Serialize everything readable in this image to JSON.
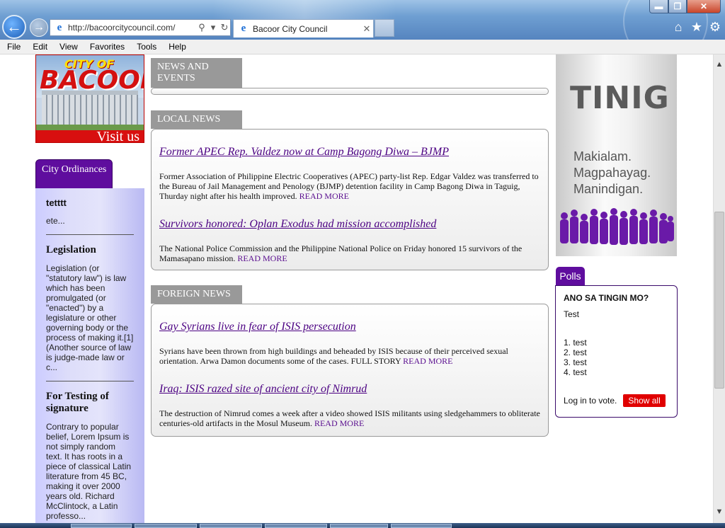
{
  "browser": {
    "url": "http://bacoorcitycouncil.com/",
    "tab_title": "Bacoor City Council",
    "menu": [
      "File",
      "Edit",
      "View",
      "Favorites",
      "Tools",
      "Help"
    ]
  },
  "logo": {
    "line1": "CITY OF",
    "line2": "BACOOR",
    "visit": "Visit us"
  },
  "ordinances": {
    "tab_label": "City Ordinances",
    "items": [
      {
        "title": "tetttt",
        "body": "ete..."
      },
      {
        "title": "Legislation",
        "body": "Legislation (or \"statutory law\") is law which has been promulgated (or \"enacted\") by a legislature or other governing body or the process of making it.[1] (Another source of law is judge-made law or c..."
      },
      {
        "title": "For Testing of signature",
        "body": "Contrary to popular belief, Lorem Ipsum is not simply random text. It has roots in a piece of classical Latin literature from 45 BC, making it over 2000 years old. Richard McClintock, a Latin professo..."
      }
    ]
  },
  "news_events": {
    "tab_label": "NEWS AND EVENTS"
  },
  "local_news": {
    "tab_label": "LOCAL NEWS",
    "articles": [
      {
        "title": "Former APEC Rep. Valdez now at Camp Bagong Diwa – BJMP",
        "body": "Former Association of Philippine Electric Cooperatives (APEC) party-list Rep. Edgar Valdez was transferred to the Bureau of Jail Management and Penology (BJMP) detention facility in Camp Bagong Diwa in Taguig, Thurday night after his health improved.",
        "read_more": "READ MORE"
      },
      {
        "title": "Survivors honored: Oplan Exodus had mission accomplished",
        "body": "The National Police Commission and the Philippine National Police on Friday honored 15 survivors of the Mamasapano mission.",
        "read_more": "READ MORE"
      }
    ]
  },
  "foreign_news": {
    "tab_label": "FOREIGN NEWS",
    "articles": [
      {
        "title": "Gay Syrians live in fear of ISIS persecution",
        "body": "Syrians have been thrown from high buildings and beheaded by ISIS because of their perceived sexual orientation. Arwa Damon documents some of the cases. FULL STORY",
        "read_more": "READ MORE"
      },
      {
        "title": "Iraq: ISIS razed site of ancient city of Nimrud",
        "body": "The destruction of Nimrud comes a week after a video showed ISIS militants using sledgehammers to obliterate centuries-old artifacts in the Mosul Museum.",
        "read_more": "READ MORE"
      }
    ]
  },
  "tinig": {
    "title": "TINIG",
    "lines": [
      "Makialam.",
      "Magpahayag.",
      "Manindigan."
    ]
  },
  "polls": {
    "tab_label": "Polls",
    "question": "ANO SA TINGIN MO?",
    "subtitle": "Test",
    "options": [
      "1. test",
      "2. test",
      "3. test",
      "4. test"
    ],
    "login_text": "Log in to vote.",
    "show_all": "Show all"
  }
}
